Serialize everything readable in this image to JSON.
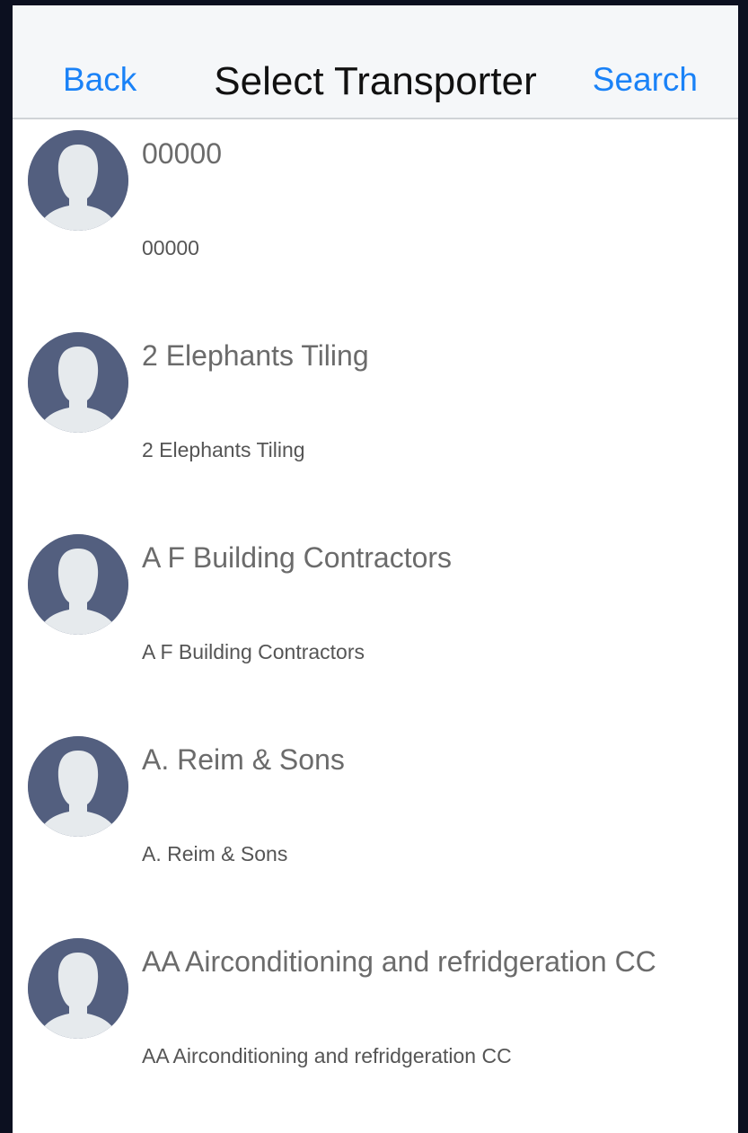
{
  "nav": {
    "back_label": "Back",
    "title": "Select Transporter",
    "search_label": "Search"
  },
  "colors": {
    "accent": "#1a82f7",
    "avatar_bg": "#535f7f",
    "avatar_fg": "#e6eaed"
  },
  "transporters": [
    {
      "title": "00000",
      "subtitle": "00000",
      "icon": "user-avatar-icon"
    },
    {
      "title": "2 Elephants Tiling",
      "subtitle": "2 Elephants Tiling",
      "icon": "user-avatar-icon"
    },
    {
      "title": "A F Building Contractors",
      "subtitle": "A F Building Contractors",
      "icon": "user-avatar-icon"
    },
    {
      "title": "A. Reim & Sons",
      "subtitle": "A. Reim & Sons",
      "icon": "user-avatar-icon"
    },
    {
      "title": "AA Airconditioning and refridgeration CC",
      "subtitle": "AA Airconditioning and refridgeration CC",
      "icon": "user-avatar-icon"
    }
  ]
}
